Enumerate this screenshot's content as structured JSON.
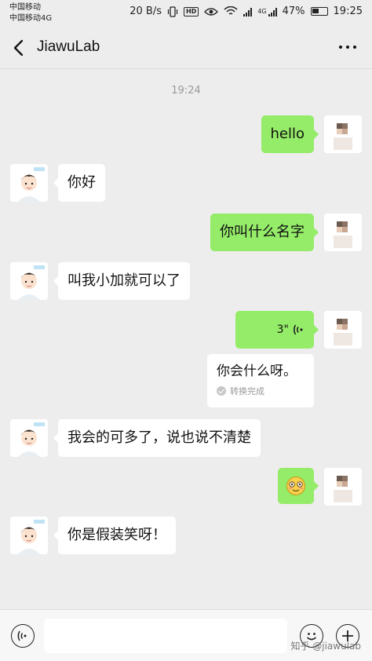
{
  "status_bar": {
    "carrier1": "中国移动",
    "carrier2": "中国移动4G",
    "speed": "20 B/s",
    "network": "4G",
    "battery": "47%",
    "time": "19:25"
  },
  "header": {
    "title": "JiawuLab"
  },
  "chat": {
    "timestamp": "19:24",
    "messages": [
      {
        "from": "me",
        "text": "hello"
      },
      {
        "from": "bot",
        "text": "你好"
      },
      {
        "from": "me",
        "text": "你叫什么名字"
      },
      {
        "from": "bot",
        "text": "叫我小加就可以了"
      },
      {
        "from": "me",
        "type": "voice",
        "duration": "3\"",
        "transcript": "你会什么呀。",
        "transcript_status": "转换完成"
      },
      {
        "from": "bot",
        "text": "我会的可多了，说也说不清楚"
      },
      {
        "from": "me",
        "type": "emoji",
        "emoji": "😳"
      },
      {
        "from": "bot",
        "text": "你是假装笑呀！"
      }
    ]
  },
  "watermark": "知乎 @jiawulab",
  "icons": {
    "back": "chevron-left-icon",
    "more": "more-dots-icon",
    "voice_toggle": "voice-icon",
    "emoji": "emoji-icon",
    "plus": "plus-icon"
  },
  "colors": {
    "out_bubble": "#95ec69",
    "in_bubble": "#ffffff",
    "background": "#ededed"
  }
}
